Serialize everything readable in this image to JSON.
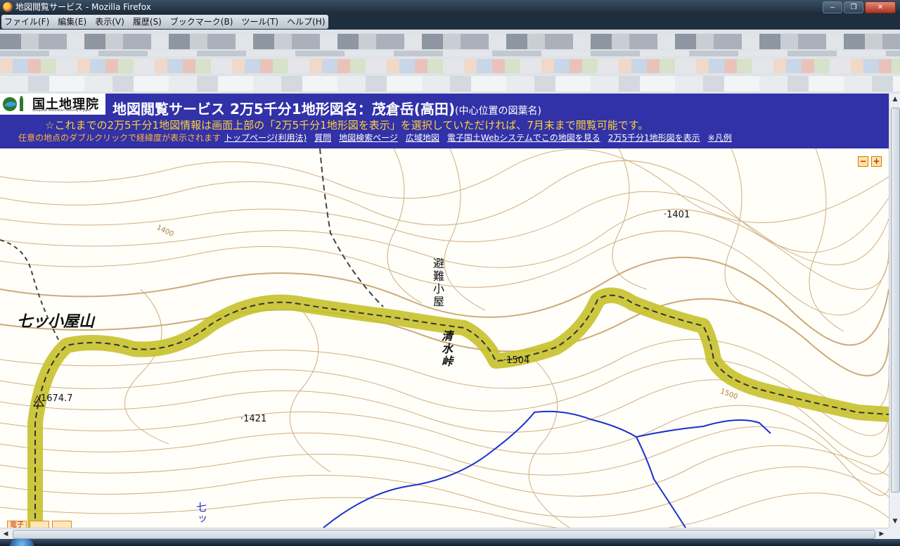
{
  "window": {
    "title": "地図閲覧サービス - Mozilla Firefox",
    "controls": {
      "minimize": "‒",
      "maximize": "❐",
      "close": "✕"
    }
  },
  "menubar": {
    "items": [
      {
        "label": "ファイル(F)"
      },
      {
        "label": "編集(E)"
      },
      {
        "label": "表示(V)"
      },
      {
        "label": "履歴(S)"
      },
      {
        "label": "ブックマーク(B)"
      },
      {
        "label": "ツール(T)"
      },
      {
        "label": "ヘルプ(H)"
      }
    ]
  },
  "header": {
    "logo_text": "国土地理院",
    "logo_subtitle": "Geospatial Information Authority of Japan",
    "title_main": "地図閲覧サービス 2万5千分1地形図名：茂倉岳(高田)",
    "title_sub": "(中心位置の図葉名)",
    "notice": "☆これまでの2万5千分1地図情報は画面上部の「2万5千分1地形図を表示」を選択していただければ、7月末まで閲覧可能です。",
    "help_text": "任意の地点のダブルクリックで経緯度が表示されます",
    "links": [
      {
        "label": "トップページ(利用法)"
      },
      {
        "label": "質問"
      },
      {
        "label": "地図検索ページ"
      },
      {
        "label": "広域地図"
      },
      {
        "label": "電子国土Webシステムでこの地図を見る"
      },
      {
        "label": "2万5千分1地形図を表示"
      },
      {
        "label": "※凡例"
      }
    ]
  },
  "map": {
    "zoom_out": "−",
    "zoom_in": "+",
    "labels": {
      "mountain": "七ッ小屋山",
      "hut": "避難小屋",
      "pass": "清水峠",
      "elev_1674": "△1674.7",
      "elev_1421": "·1421",
      "elev_1504": "·1504",
      "elev_1401": "·1401",
      "contour_1400": "1400",
      "contour_1500": "1500",
      "stream": "七ッ"
    },
    "bottom_buttons": [
      "電子",
      "",
      ""
    ],
    "colors": {
      "contour": "#c8a26b",
      "route_highlight": "#c7c12a",
      "river": "#1a2fd0",
      "trail": "#333333"
    }
  }
}
